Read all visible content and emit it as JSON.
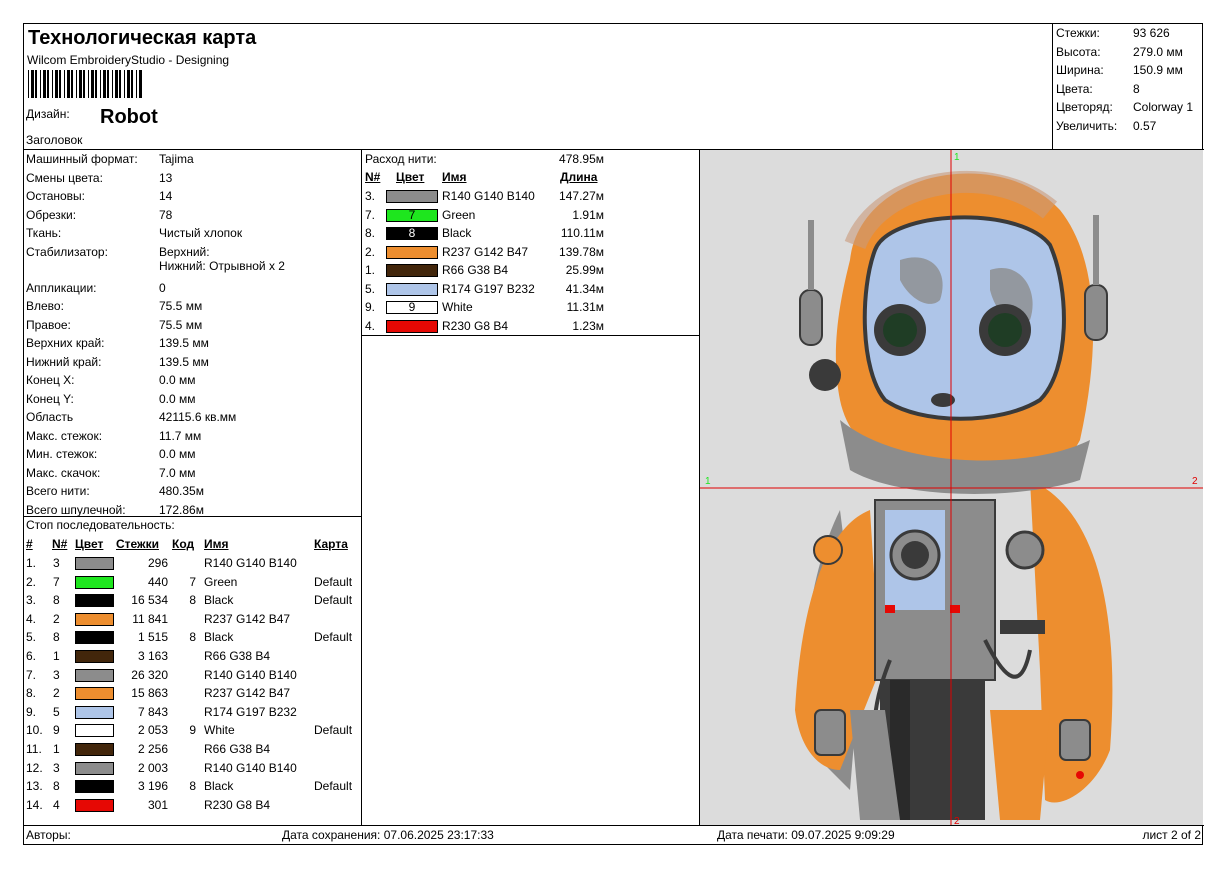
{
  "header": {
    "title": "Технологическая карта",
    "software": "Wilcom EmbroideryStudio - Designing",
    "design_label": "Дизайн:",
    "design_name": "Robot",
    "heading_label": "Заголовок"
  },
  "summary": [
    {
      "label": "Стежки:",
      "value": "93 626"
    },
    {
      "label": "Высота:",
      "value": "279.0 мм"
    },
    {
      "label": "Ширина:",
      "value": "150.9 мм"
    },
    {
      "label": "Цвета:",
      "value": "8"
    },
    {
      "label": "Цветоряд:",
      "value": "Colorway 1"
    },
    {
      "label": "Увеличить:",
      "value": "0.57"
    }
  ],
  "params": [
    {
      "label": "Машинный формат:",
      "value": "Tajima"
    },
    {
      "label": "Смены цвета:",
      "value": "13"
    },
    {
      "label": "Остановы:",
      "value": "14"
    },
    {
      "label": "Обрезки:",
      "value": "78"
    },
    {
      "label": "Ткань:",
      "value": "Чистый хлопок"
    },
    {
      "label": "Стабилизатор:",
      "value": "Верхний:",
      "value2": "Нижний: Отрывной x 2"
    },
    {
      "label": "Аппликации:",
      "value": "0"
    },
    {
      "label": "Влево:",
      "value": "75.5 мм"
    },
    {
      "label": "Правое:",
      "value": "75.5 мм"
    },
    {
      "label": "Верхних край:",
      "value": "139.5 мм"
    },
    {
      "label": "Нижний край:",
      "value": "139.5 мм"
    },
    {
      "label": "Конец X:",
      "value": "0.0 мм"
    },
    {
      "label": "Конец Y:",
      "value": "0.0 мм"
    },
    {
      "label": "Область",
      "value": "42115.6 кв.мм"
    },
    {
      "label": "Макс. стежок:",
      "value": "11.7 мм"
    },
    {
      "label": "Мин. стежок:",
      "value": "0.0 мм"
    },
    {
      "label": "Макс. скачок:",
      "value": "7.0 мм"
    },
    {
      "label": "Всего нити:",
      "value": "480.35м"
    },
    {
      "label": "Всего шпулечной:",
      "value": "172.86м"
    }
  ],
  "stop_sequence": {
    "title": "Стоп последовательность:",
    "headers": {
      "n": "#",
      "needle": "N#",
      "color": "Цвет",
      "stitches": "Стежки",
      "code": "Код",
      "name": "Имя",
      "chart": "Карта"
    },
    "rows": [
      {
        "n": "1.",
        "needle": "3",
        "color": "#8c8c8c",
        "stitches": "296",
        "code": "",
        "name": "R140 G140 B140",
        "chart": ""
      },
      {
        "n": "2.",
        "needle": "7",
        "color": "#1ee61e",
        "stitches": "440",
        "code": "7",
        "name": "Green",
        "chart": "Default"
      },
      {
        "n": "3.",
        "needle": "8",
        "color": "#000000",
        "stitches": "16 534",
        "code": "8",
        "name": "Black",
        "chart": "Default"
      },
      {
        "n": "4.",
        "needle": "2",
        "color": "#ed8e2f",
        "stitches": "11 841",
        "code": "",
        "name": "R237 G142 B47",
        "chart": ""
      },
      {
        "n": "5.",
        "needle": "8",
        "color": "#000000",
        "stitches": "1 515",
        "code": "8",
        "name": "Black",
        "chart": "Default"
      },
      {
        "n": "6.",
        "needle": "1",
        "color": "#42260b",
        "stitches": "3 163",
        "code": "",
        "name": "R66 G38 B4",
        "chart": ""
      },
      {
        "n": "7.",
        "needle": "3",
        "color": "#8c8c8c",
        "stitches": "26 320",
        "code": "",
        "name": "R140 G140 B140",
        "chart": ""
      },
      {
        "n": "8.",
        "needle": "2",
        "color": "#ed8e2f",
        "stitches": "15 863",
        "code": "",
        "name": "R237 G142 B47",
        "chart": ""
      },
      {
        "n": "9.",
        "needle": "5",
        "color": "#aec5e8",
        "stitches": "7 843",
        "code": "",
        "name": "R174 G197 B232",
        "chart": ""
      },
      {
        "n": "10.",
        "needle": "9",
        "color": "#ffffff",
        "stitches": "2 053",
        "code": "9",
        "name": "White",
        "chart": "Default"
      },
      {
        "n": "11.",
        "needle": "1",
        "color": "#42260b",
        "stitches": "2 256",
        "code": "",
        "name": "R66 G38 B4",
        "chart": ""
      },
      {
        "n": "12.",
        "needle": "3",
        "color": "#8c8c8c",
        "stitches": "2 003",
        "code": "",
        "name": "R140 G140 B140",
        "chart": ""
      },
      {
        "n": "13.",
        "needle": "8",
        "color": "#000000",
        "stitches": "3 196",
        "code": "8",
        "name": "Black",
        "chart": "Default"
      },
      {
        "n": "14.",
        "needle": "4",
        "color": "#e60804",
        "stitches": "301",
        "code": "",
        "name": "R230 G8 B4",
        "chart": ""
      }
    ]
  },
  "thread_usage": {
    "label": "Расход нити:",
    "total": "478.95м",
    "headers": {
      "needle": "N#",
      "color": "Цвет",
      "name": "Имя",
      "length": "Длина"
    },
    "rows": [
      {
        "needle": "3.",
        "color": "#8c8c8c",
        "code": "",
        "name": "R140 G140 B140",
        "length": "147.27м"
      },
      {
        "needle": "7.",
        "color": "#1ee61e",
        "code": "7",
        "name": "Green",
        "length": "1.91м"
      },
      {
        "needle": "8.",
        "color": "#000000",
        "code": "8",
        "name": "Black",
        "length": "110.11м"
      },
      {
        "needle": "2.",
        "color": "#ed8e2f",
        "code": "",
        "name": "R237 G142 B47",
        "length": "139.78м"
      },
      {
        "needle": "1.",
        "color": "#42260b",
        "code": "",
        "name": "R66 G38 B4",
        "length": "25.99м"
      },
      {
        "needle": "5.",
        "color": "#aec5e8",
        "code": "",
        "name": "R174 G197 B232",
        "length": "41.34м"
      },
      {
        "needle": "9.",
        "color": "#ffffff",
        "code": "9",
        "name": "White",
        "length": "11.31м"
      },
      {
        "needle": "4.",
        "color": "#e60804",
        "code": "",
        "name": "R230 G8 B4",
        "length": "1.23м"
      }
    ]
  },
  "preview": {
    "axis_top": "1",
    "axis_left": "1",
    "axis_right": "2",
    "axis_bottom": "2",
    "colors": {
      "orange": "#ed8e2f",
      "grey": "#8c8c8c",
      "dark": "#3a3a3a",
      "visor": "#aec5e8",
      "bg": "#dcdcdc",
      "cross": "#e00000",
      "green": "#1ee61e"
    }
  },
  "footer": {
    "authors": "Авторы:",
    "saved": "Дата сохранения: 07.06.2025 23:17:33",
    "printed": "Дата печати: 09.07.2025 9:09:29",
    "sheet": "лист 2 of 2"
  }
}
